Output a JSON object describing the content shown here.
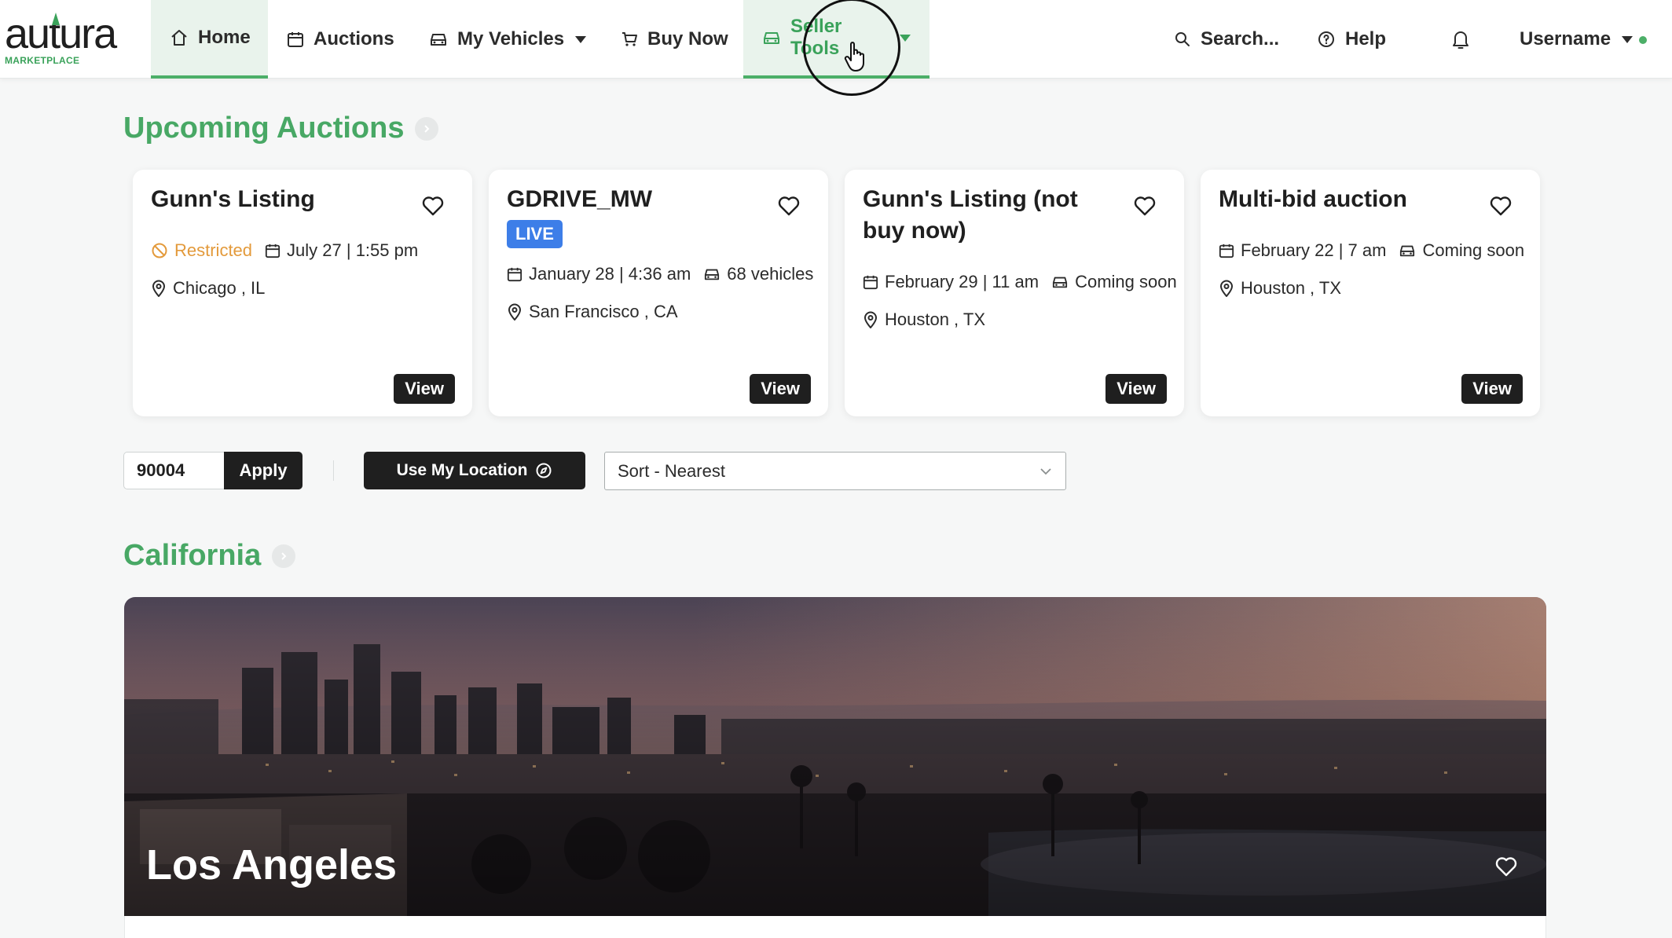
{
  "brand": {
    "name": "autura",
    "sub": "MARKETPLACE"
  },
  "nav": {
    "home": "Home",
    "auctions": "Auctions",
    "my_vehicles": "My Vehicles",
    "buy_now": "Buy Now",
    "seller_tools": "Seller Tools",
    "search": "Search...",
    "help": "Help",
    "username": "Username"
  },
  "upcoming": {
    "title": "Upcoming Auctions",
    "cards": [
      {
        "title": "Gunn's Listing",
        "status": "Restricted",
        "date": "July 27 | 1:55 pm",
        "location": "Chicago , IL",
        "view": "View"
      },
      {
        "title": "GDRIVE_MW",
        "badge": "LIVE",
        "date": "January 28 | 4:36 am",
        "vehicles": "68 vehicles",
        "location": "San Francisco , CA",
        "view": "View"
      },
      {
        "title": "Gunn's Listing (not buy now)",
        "date": "February 29 | 11 am",
        "vehicles": "Coming soon",
        "location": "Houston , TX",
        "view": "View"
      },
      {
        "title": "Multi-bid auction",
        "date": "February 22 | 7 am",
        "vehicles": "Coming soon",
        "location": "Houston , TX",
        "view": "View"
      }
    ]
  },
  "filters": {
    "zip_value": "90004",
    "apply": "Apply",
    "use_location": "Use My Location",
    "sort": "Sort - Nearest"
  },
  "region": {
    "title": "California",
    "city": "Los Angeles"
  },
  "colors": {
    "brand_green": "#48a865",
    "live_blue": "#3d7ee8",
    "restricted_orange": "#e39a3b"
  }
}
